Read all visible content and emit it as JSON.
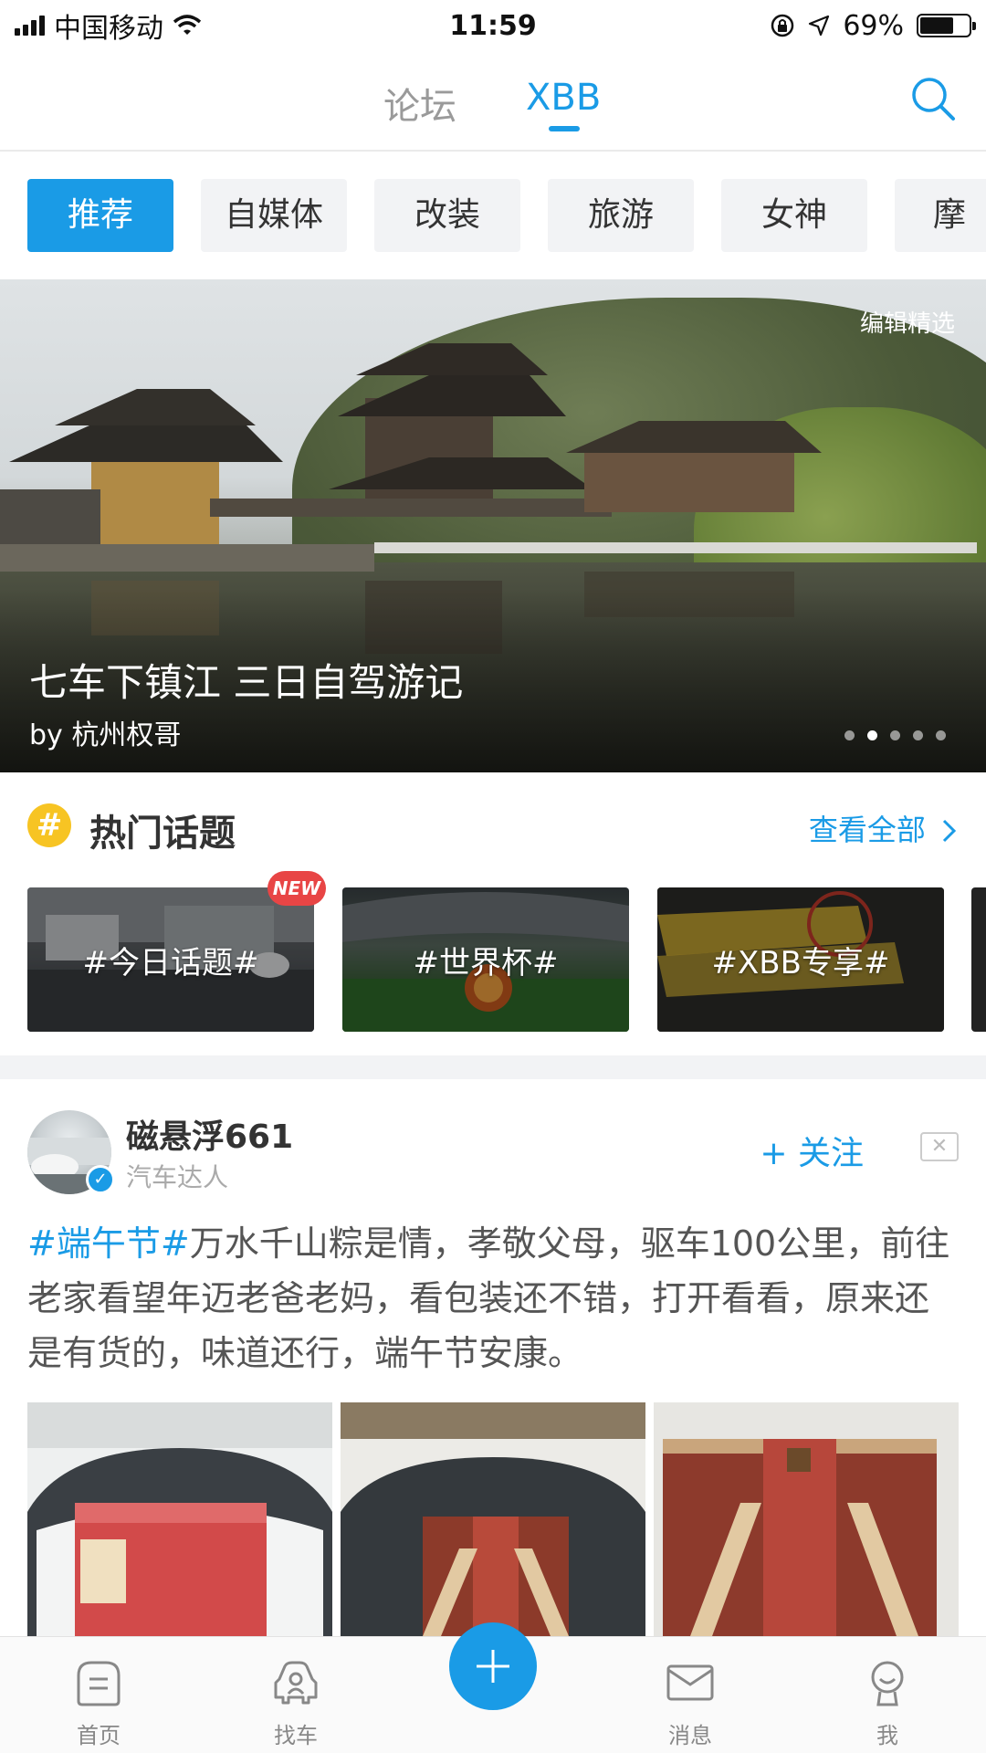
{
  "status_bar": {
    "carrier": "中国移动",
    "time": "11:59",
    "battery": "69%",
    "battery_level": 0.69
  },
  "top_nav": {
    "tabs": [
      "论坛",
      "XBB"
    ],
    "active_tab": "XBB"
  },
  "categories": {
    "items": [
      "推荐",
      "自媒体",
      "改装",
      "旅游",
      "女神",
      "摩"
    ],
    "active": "推荐"
  },
  "hero": {
    "badge": "编辑精选",
    "title": "七车下镇江 三日自驾游记",
    "author": "by 杭州权哥",
    "page_count": 5,
    "current_page": 2
  },
  "hot_topics": {
    "title": "热门话题",
    "view_all": "查看全部",
    "items": [
      {
        "label": "#今日话题#",
        "badge": "NEW"
      },
      {
        "label": "#世界杯#"
      },
      {
        "label": "#XBB专享#"
      }
    ]
  },
  "post": {
    "author_name": "磁悬浮661",
    "author_role": "汽车达人",
    "follow_label": "+ 关注",
    "hashtag": "#端午节#",
    "body": "万水千山粽是情，孝敬父母，驱车100公里，前往老家看望年迈老爸老妈，看包装还不错，打开看看，原来还是有货的，味道还行，端午节安康。"
  },
  "tabbar": {
    "items": [
      "首页",
      "找车",
      "消息",
      "我"
    ]
  },
  "colors": {
    "accent": "#1a9be6",
    "new_badge": "#e84545",
    "topic_icon": "#f7c423"
  },
  "icons": {
    "search": "search-icon",
    "topic": "hash-icon",
    "verified": "check-icon",
    "close": "close-icon",
    "home": "home-icon",
    "find_car": "car-icon",
    "add": "plus-icon",
    "messages": "mail-icon",
    "profile": "person-icon"
  }
}
